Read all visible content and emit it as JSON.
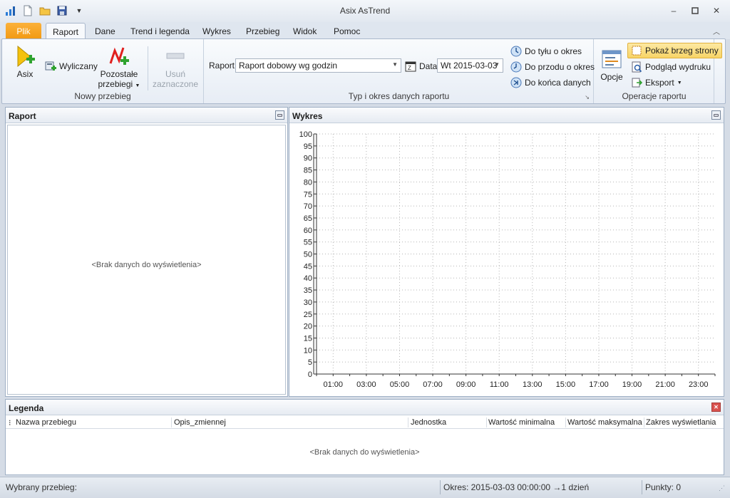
{
  "window": {
    "title": "Asix AsTrend"
  },
  "tabs": [
    "Plik",
    "Raport",
    "Dane",
    "Trend i legenda",
    "Wykres",
    "Przebieg",
    "Widok",
    "Pomoc"
  ],
  "ribbon": {
    "nowy_przebieg": {
      "label": "Nowy przebieg",
      "asix": "Asix",
      "wyliczany": "Wyliczany",
      "pozostale_1": "Pozostałe",
      "pozostale_2": "przebiegi",
      "usun_1": "Usuń",
      "usun_2": "zaznaczone"
    },
    "typ_okres": {
      "label": "Typ i okres danych raportu",
      "raport_label": "Raport",
      "raport_value": "Raport dobowy wg godzin",
      "data_label": "Data",
      "data_value": "Wt 2015-03-03",
      "do_tylu": "Do tyłu o okres",
      "do_przodu": "Do przodu o okres",
      "do_konca": "Do końca danych"
    },
    "operacje": {
      "label": "Operacje raportu",
      "opcje": "Opcje",
      "pokaz_brzeg": "Pokaż brzeg strony",
      "podglad": "Podgląd wydruku",
      "eksport": "Eksport"
    }
  },
  "panels": {
    "raport": {
      "title": "Raport",
      "empty": "<Brak danych do wyświetlenia>"
    },
    "wykres": {
      "title": "Wykres"
    },
    "legenda": {
      "title": "Legenda",
      "columns": [
        "Nazwa przebiegu",
        "Opis_zmiennej",
        "Jednostka",
        "Wartość minimalna",
        "Wartość maksymalna",
        "Zakres wyświetlania"
      ],
      "empty": "<Brak danych do wyświetlenia>"
    }
  },
  "chart_data": {
    "type": "line",
    "yticks": [
      100,
      95,
      90,
      85,
      80,
      75,
      70,
      65,
      60,
      55,
      50,
      45,
      40,
      35,
      30,
      25,
      20,
      15,
      10,
      5,
      0
    ],
    "xticks": [
      "01:00",
      "03:00",
      "05:00",
      "07:00",
      "09:00",
      "11:00",
      "13:00",
      "15:00",
      "17:00",
      "19:00",
      "21:00",
      "23:00"
    ],
    "ylim": [
      0,
      100
    ],
    "xlim": [
      "00:00",
      "24:00"
    ],
    "grid": true,
    "series": []
  },
  "status": {
    "wybrany": "Wybrany przebieg:",
    "okres": "Okres: 2015-03-03  00:00:00 →1 dzień",
    "punkty": "Punkty: 0"
  }
}
